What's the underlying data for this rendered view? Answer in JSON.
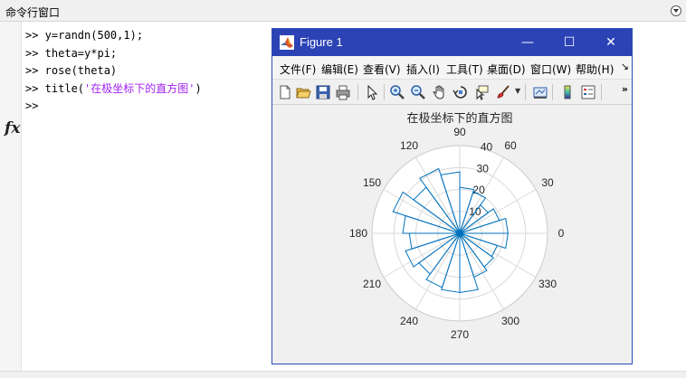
{
  "command_window": {
    "title": "命令行窗口",
    "prompt": ">>",
    "lines": [
      {
        "code": " y=randn(500,1);",
        "str": ""
      },
      {
        "code": " theta=y*pi;",
        "str": ""
      },
      {
        "code": " rose(theta)",
        "str": ""
      },
      {
        "code": " title(",
        "str": "'在极坐标下的直方图'",
        "tail": ")"
      },
      {
        "code": "",
        "str": ""
      }
    ],
    "fx_label": "fx"
  },
  "figure_window": {
    "title": "Figure 1",
    "controls": {
      "minimize": "—",
      "maximize": "☐",
      "close": "✕"
    },
    "menu": [
      "文件(F)",
      "编辑(E)",
      "查看(V)",
      "插入(I)",
      "工具(T)",
      "桌面(D)",
      "窗口(W)",
      "帮助(H)"
    ],
    "menu_more": "↘",
    "toolbar_icons": [
      "new-figure-icon",
      "open-file-icon",
      "save-icon",
      "print-icon",
      "pointer-icon",
      "zoom-in-icon",
      "zoom-out-icon",
      "pan-hand-icon",
      "rotate-3d-icon",
      "data-cursor-icon",
      "brush-icon",
      "link-plot-icon",
      "colorbar-icon",
      "legend-icon"
    ],
    "toolbar_more": "»"
  },
  "chart_data": {
    "type": "polar-histogram",
    "title": "在极坐标下的直方图",
    "angle_ticks": [
      0,
      30,
      60,
      90,
      120,
      150,
      180,
      210,
      240,
      270,
      300,
      330
    ],
    "radius_ticks": [
      10,
      20,
      30,
      40
    ],
    "rlim": [
      0,
      40
    ],
    "bins": 20,
    "counts": [
      22,
      19,
      16,
      20,
      21,
      28,
      31,
      26,
      32,
      26,
      23,
      26,
      23,
      26,
      27,
      27,
      21,
      19,
      18,
      22
    ],
    "line_color": "#0072bd",
    "grid_color": "#d9d9d9"
  }
}
